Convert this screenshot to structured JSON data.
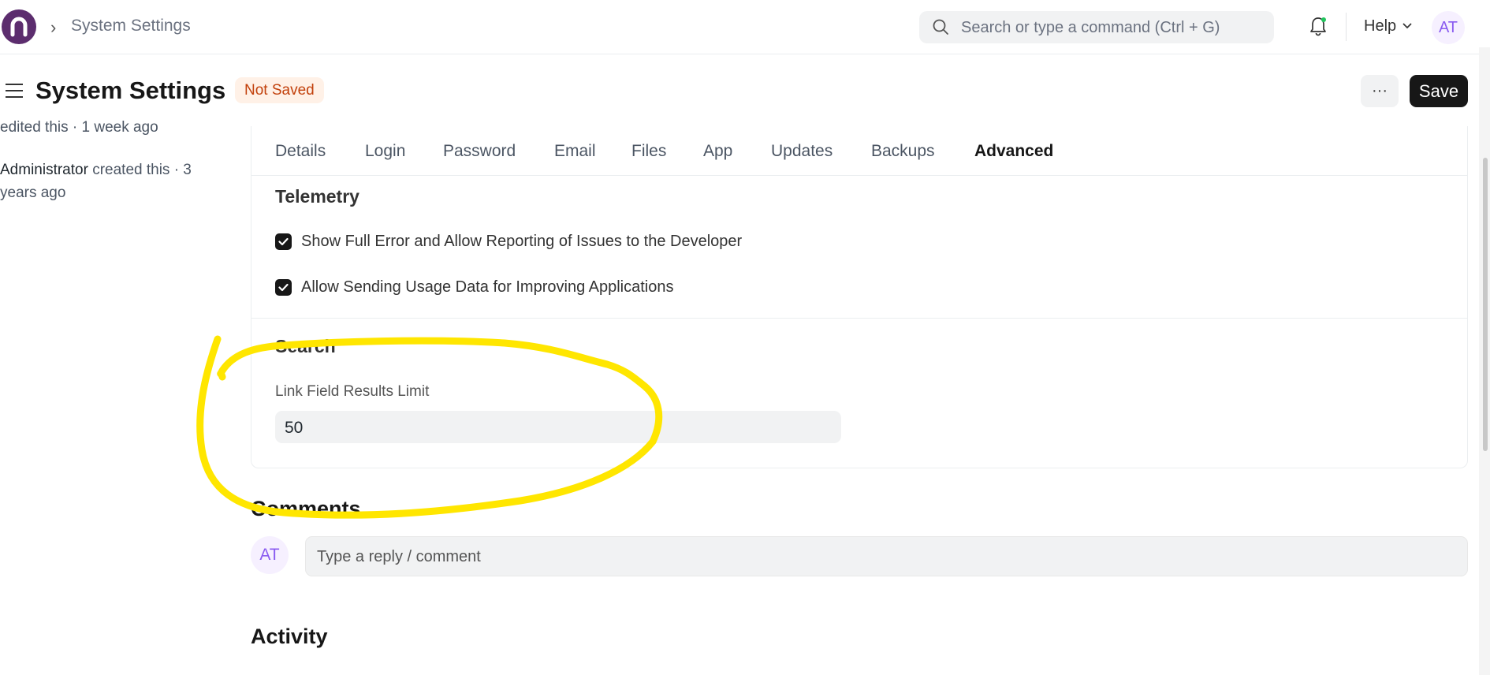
{
  "navbar": {
    "breadcrumb": "System Settings",
    "search_placeholder": "Search or type a command (Ctrl + G)",
    "help_label": "Help",
    "user_initials": "AT"
  },
  "page": {
    "title": "System Settings",
    "status_badge": "Not Saved",
    "more_label": "···",
    "save_label": "Save"
  },
  "sidebar": {
    "edited_text": "edited this · 1 week ago",
    "created_user": "Administrator",
    "created_text": " created this · 3 years ago"
  },
  "tabs": [
    {
      "label": "Details",
      "active": false
    },
    {
      "label": "Login",
      "active": false
    },
    {
      "label": "Password",
      "active": false
    },
    {
      "label": "Email",
      "active": false
    },
    {
      "label": "Files",
      "active": false
    },
    {
      "label": "App",
      "active": false
    },
    {
      "label": "Updates",
      "active": false
    },
    {
      "label": "Backups",
      "active": false
    },
    {
      "label": "Advanced",
      "active": true
    }
  ],
  "telemetry": {
    "title": "Telemetry",
    "checkbox1_label": "Show Full Error and Allow Reporting of Issues to the Developer",
    "checkbox1_checked": true,
    "checkbox2_label": "Allow Sending Usage Data for Improving Applications",
    "checkbox2_checked": true
  },
  "search_section": {
    "title": "Search",
    "field_label": "Link Field Results Limit",
    "field_value": "50"
  },
  "comments": {
    "title": "Comments",
    "avatar_initials": "AT",
    "placeholder": "Type a reply / comment"
  },
  "activity": {
    "title": "Activity"
  },
  "colors": {
    "brand": "#5c2d6e",
    "badge_bg": "#fff1e7",
    "badge_text": "#c2410c",
    "highlight": "#ffe600",
    "save_bg": "#171717"
  }
}
